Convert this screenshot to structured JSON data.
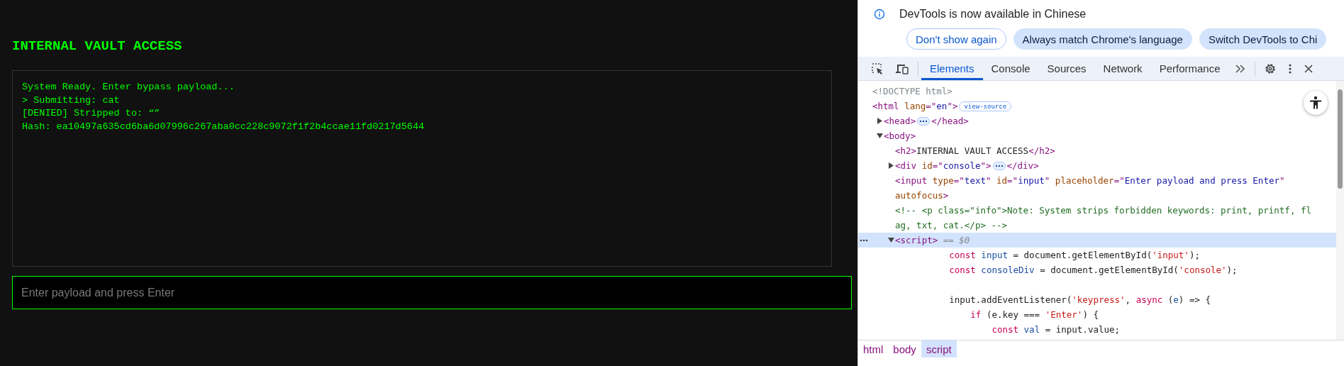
{
  "page": {
    "title": "INTERNAL VAULT ACCESS",
    "console_lines": [
      "System Ready. Enter bypass payload...",
      "> Submitting: cat",
      "[DENIED] Stripped to: “”",
      "Hash: ea10497a635cd6ba6d07996c267aba0cc228c9072f1f2b4ccae11fd0217d5644"
    ],
    "input": {
      "placeholder": "Enter payload and press Enter"
    }
  },
  "devtools": {
    "banner": {
      "message": "DevTools is now available in Chinese",
      "buttons": [
        {
          "label": "Don't show again",
          "kind": "outline"
        },
        {
          "label": "Always match Chrome's language",
          "kind": "filled"
        },
        {
          "label": "Switch DevTools to Chi",
          "kind": "filled"
        }
      ]
    },
    "tabs": [
      {
        "label": "Elements",
        "selected": true
      },
      {
        "label": "Console",
        "selected": false
      },
      {
        "label": "Sources",
        "selected": false
      },
      {
        "label": "Network",
        "selected": false
      },
      {
        "label": "Performance",
        "selected": false
      }
    ],
    "tree": [
      {
        "selected": false,
        "lines": [
          [
            {
              "t": "<!DOCTYPE html>",
              "kind": "doctype"
            }
          ]
        ]
      },
      {
        "selected": false,
        "lines": [
          [
            {
              "t": "<html ",
              "kind": "tag"
            },
            {
              "t": "lang",
              "kind": "attr"
            },
            {
              "t": "=\"",
              "kind": "tag"
            },
            {
              "t": "en",
              "kind": "value"
            },
            {
              "t": "\">",
              "kind": "tag"
            },
            {
              "t": "view-source",
              "kind": "badge"
            }
          ]
        ],
        "children": [
          {
            "selected": false,
            "expanded": false,
            "lines": [
              [
                {
                  "t": "<head>",
                  "kind": "tag"
                },
                {
                  "kind": "more"
                },
                {
                  "t": "</head>",
                  "kind": "tag"
                }
              ]
            ]
          },
          {
            "selected": false,
            "expanded": true,
            "lines": [
              [
                {
                  "t": "<body>",
                  "kind": "tag"
                }
              ]
            ],
            "children": [
              {
                "selected": false,
                "lines": [
                  [
                    {
                      "t": "<h2>",
                      "kind": "tag"
                    },
                    {
                      "t": "INTERNAL VAULT ACCESS",
                      "kind": "text"
                    },
                    {
                      "t": "</h2>",
                      "kind": "tag"
                    }
                  ]
                ]
              },
              {
                "selected": false,
                "expanded": false,
                "lines": [
                  [
                    {
                      "t": "<div ",
                      "kind": "tag"
                    },
                    {
                      "t": "id",
                      "kind": "attr"
                    },
                    {
                      "t": "=\"",
                      "kind": "tag"
                    },
                    {
                      "t": "console",
                      "kind": "value"
                    },
                    {
                      "t": "\">",
                      "kind": "tag"
                    },
                    {
                      "kind": "more"
                    },
                    {
                      "t": "</div>",
                      "kind": "tag"
                    }
                  ]
                ]
              },
              {
                "selected": false,
                "lines": [
                  [
                    {
                      "t": "<input ",
                      "kind": "tag"
                    },
                    {
                      "t": "type",
                      "kind": "attr"
                    },
                    {
                      "t": "=\"",
                      "kind": "tag"
                    },
                    {
                      "t": "text",
                      "kind": "value"
                    },
                    {
                      "t": "\" ",
                      "kind": "tag"
                    },
                    {
                      "t": "id",
                      "kind": "attr"
                    },
                    {
                      "t": "=\"",
                      "kind": "tag"
                    },
                    {
                      "t": "input",
                      "kind": "value"
                    },
                    {
                      "t": "\" ",
                      "kind": "tag"
                    },
                    {
                      "t": "placeholder",
                      "kind": "attr"
                    },
                    {
                      "t": "=\"",
                      "kind": "tag"
                    },
                    {
                      "t": "Enter payload and press Enter",
                      "kind": "value"
                    },
                    {
                      "t": "\"",
                      "kind": "tag"
                    }
                  ],
                  [
                    {
                      "t": "autofocus",
                      "kind": "attr"
                    },
                    {
                      "t": ">",
                      "kind": "tag"
                    }
                  ]
                ]
              },
              {
                "selected": false,
                "lines": [
                  [
                    {
                      "t": "<!-- <p class=\"info\">Note: System strips forbidden keywords: print, printf, fl",
                      "kind": "comment"
                    }
                  ],
                  [
                    {
                      "t": "ag, txt, cat.</p> -->",
                      "kind": "comment"
                    }
                  ]
                ]
              },
              {
                "selected": true,
                "expanded": true,
                "lines": [
                  [
                    {
                      "t": "<script>",
                      "kind": "tag"
                    },
                    {
                      "t": " == $0",
                      "kind": "dollar"
                    }
                  ]
                ],
                "children": [
                  {
                    "selected": false,
                    "lines": [
                      [
                        {
                          "t": "        const ",
                          "kind": "keyword"
                        },
                        {
                          "t": "input",
                          "kind": "var"
                        },
                        {
                          "t": " = document.getElementById(",
                          "kind": "plain"
                        },
                        {
                          "t": "'input'",
                          "kind": "string"
                        },
                        {
                          "t": ");",
                          "kind": "plain"
                        }
                      ]
                    ]
                  },
                  {
                    "selected": false,
                    "lines": [
                      [
                        {
                          "t": "        const ",
                          "kind": "keyword"
                        },
                        {
                          "t": "consoleDiv",
                          "kind": "var"
                        },
                        {
                          "t": " = document.getElementById(",
                          "kind": "plain"
                        },
                        {
                          "t": "'console'",
                          "kind": "string"
                        },
                        {
                          "t": ");",
                          "kind": "plain"
                        }
                      ]
                    ]
                  },
                  {
                    "selected": false,
                    "kind": "blank"
                  },
                  {
                    "selected": false,
                    "lines": [
                      [
                        {
                          "t": "        input.addEventListener(",
                          "kind": "plain"
                        },
                        {
                          "t": "'keypress'",
                          "kind": "string"
                        },
                        {
                          "t": ", ",
                          "kind": "plain"
                        },
                        {
                          "t": "async ",
                          "kind": "keyword"
                        },
                        {
                          "t": "(",
                          "kind": "plain"
                        },
                        {
                          "t": "e",
                          "kind": "var"
                        },
                        {
                          "t": ") => {",
                          "kind": "plain"
                        }
                      ]
                    ]
                  },
                  {
                    "selected": false,
                    "lines": [
                      [
                        {
                          "t": "            if ",
                          "kind": "keyword"
                        },
                        {
                          "t": "(e.key === ",
                          "kind": "plain"
                        },
                        {
                          "t": "'Enter'",
                          "kind": "string"
                        },
                        {
                          "t": ") {",
                          "kind": "plain"
                        }
                      ]
                    ]
                  },
                  {
                    "selected": false,
                    "lines": [
                      [
                        {
                          "t": "                const ",
                          "kind": "keyword"
                        },
                        {
                          "t": "val",
                          "kind": "var"
                        },
                        {
                          "t": " = input.value;",
                          "kind": "plain"
                        }
                      ]
                    ]
                  }
                ]
              }
            ]
          }
        ]
      }
    ],
    "breadcrumbs": [
      {
        "label": "html",
        "selected": false
      },
      {
        "label": "body",
        "selected": false
      },
      {
        "label": "script",
        "selected": true
      }
    ]
  }
}
